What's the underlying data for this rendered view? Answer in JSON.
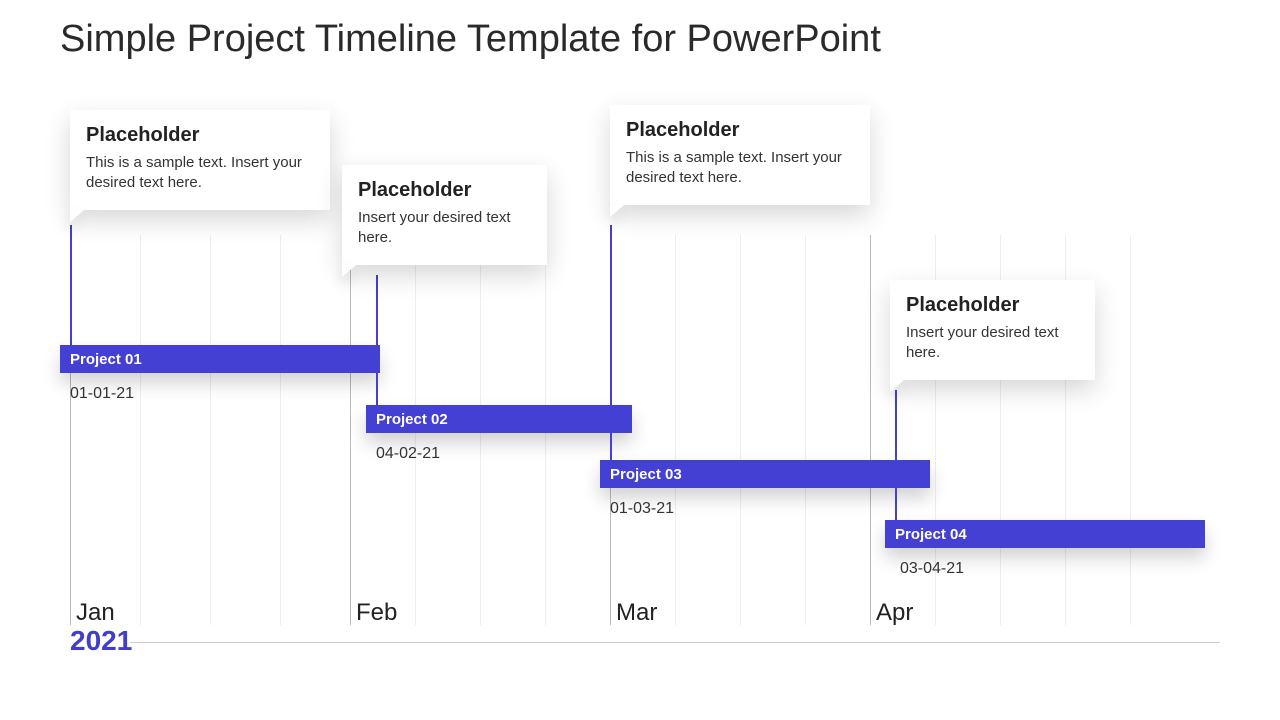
{
  "title": "Simple Project Timeline Template for PowerPoint",
  "year": "2021",
  "months": [
    "Jan",
    "Feb",
    "Mar",
    "Apr"
  ],
  "projects": [
    {
      "name": "Project 01",
      "date": "01-01-21",
      "callout_title": "Placeholder",
      "callout_body": "This is a sample text. Insert your desired text here."
    },
    {
      "name": "Project 02",
      "date": "04-02-21",
      "callout_title": "Placeholder",
      "callout_body": "Insert your desired text here."
    },
    {
      "name": "Project 03",
      "date": "01-03-21",
      "callout_title": "Placeholder",
      "callout_body": "This is a sample text. Insert your desired text here."
    },
    {
      "name": "Project 04",
      "date": "03-04-21",
      "callout_title": "Placeholder",
      "callout_body": "Insert your desired text here."
    }
  ],
  "chart_data": {
    "type": "bar",
    "title": "Simple Project Timeline Template for PowerPoint",
    "xlabel": "",
    "ylabel": "",
    "x_axis": {
      "unit": "month-of-2021",
      "ticks": [
        "Jan",
        "Feb",
        "Mar",
        "Apr"
      ]
    },
    "series": [
      {
        "name": "Project 01",
        "start": "2021-01-01",
        "end": "2021-02-04",
        "row": 1,
        "callout": "Placeholder — This is a sample text. Insert your desired text here."
      },
      {
        "name": "Project 02",
        "start": "2021-02-04",
        "end": "2021-03-01",
        "row": 2,
        "callout": "Placeholder — Insert your desired text here."
      },
      {
        "name": "Project 03",
        "start": "2021-03-01",
        "end": "2021-04-03",
        "row": 3,
        "callout": "Placeholder — This is a sample text. Insert your desired text here."
      },
      {
        "name": "Project 04",
        "start": "2021-04-03",
        "end": "2021-05-01",
        "row": 4,
        "callout": "Placeholder — Insert your desired text here."
      }
    ],
    "annotations": [
      {
        "text": "01-01-21",
        "at": "2021-01-01"
      },
      {
        "text": "04-02-21",
        "at": "2021-02-04"
      },
      {
        "text": "01-03-21",
        "at": "2021-03-01"
      },
      {
        "text": "03-04-21",
        "at": "2021-04-03"
      }
    ],
    "xlim": [
      "2021-01-01",
      "2021-05-01"
    ],
    "grid": true,
    "legend": false
  },
  "colors": {
    "accent": "#4340d3"
  }
}
